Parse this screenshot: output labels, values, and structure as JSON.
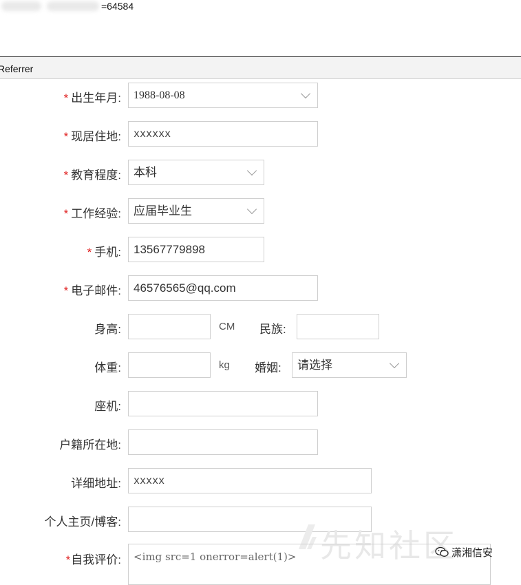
{
  "top": {
    "url_suffix": "=64584"
  },
  "refbar": {
    "label": "Referrer"
  },
  "form": {
    "birth": {
      "label": "出生年月:",
      "value": "1988-08-08"
    },
    "residence": {
      "label": "现居住地:",
      "value": "xxxxxx"
    },
    "education": {
      "label": "教育程度:",
      "value": "本科"
    },
    "experience": {
      "label": "工作经验:",
      "value": "应届毕业生"
    },
    "phone": {
      "label": "手机:",
      "value": "13567779898"
    },
    "email": {
      "label": "电子邮件:",
      "value": "46576565@qq.com"
    },
    "height": {
      "label": "身高:",
      "value": "",
      "unit": "CM"
    },
    "ethnicity": {
      "label": "民族:",
      "value": ""
    },
    "weight": {
      "label": "体重:",
      "value": "",
      "unit": "kg"
    },
    "marriage": {
      "label": "婚姻:",
      "value": "请选择"
    },
    "landline": {
      "label": "座机:",
      "value": ""
    },
    "hukou": {
      "label": "户籍所在地:",
      "value": ""
    },
    "address": {
      "label": "详细地址:",
      "value": "xxxxx"
    },
    "homepage": {
      "label": "个人主页/博客:",
      "value": ""
    },
    "self_eval": {
      "label": "自我评价:",
      "value": "<img src=1 onerror=alert(1)>"
    }
  },
  "required_mark": "*",
  "watermark": {
    "text": "先知社区"
  },
  "wechat": {
    "text": "潇湘信安",
    "icon": "wechat-icon"
  },
  "colors": {
    "required": "#e02020",
    "border": "#cfcfcf",
    "refbar_bg": "#f3f3f3"
  }
}
